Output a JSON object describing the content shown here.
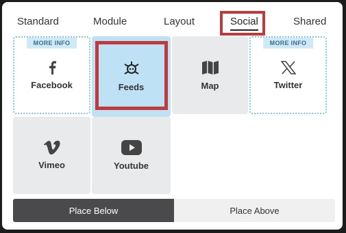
{
  "tabs": [
    {
      "label": "Standard",
      "active": false
    },
    {
      "label": "Module",
      "active": false
    },
    {
      "label": "Layout",
      "active": false
    },
    {
      "label": "Social",
      "active": true
    },
    {
      "label": "Shared",
      "active": false
    }
  ],
  "tiles": {
    "facebook": {
      "label": "Facebook",
      "badge": "MORE INFO",
      "icon": "facebook-icon"
    },
    "feeds": {
      "label": "Feeds",
      "icon": "feeds-icon",
      "selected": true
    },
    "map": {
      "label": "Map",
      "icon": "map-icon"
    },
    "twitter": {
      "label": "Twitter",
      "badge": "MORE INFO",
      "icon": "x-icon"
    },
    "vimeo": {
      "label": "Vimeo",
      "icon": "vimeo-icon"
    },
    "youtube": {
      "label": "Youtube",
      "icon": "youtube-icon"
    }
  },
  "placement": {
    "below_label": "Place Below",
    "above_label": "Place Above",
    "selected": "below"
  },
  "colors": {
    "highlight": "#c0393b",
    "selected_tile": "#bfe1f5",
    "active_button": "#4a4a4c"
  }
}
